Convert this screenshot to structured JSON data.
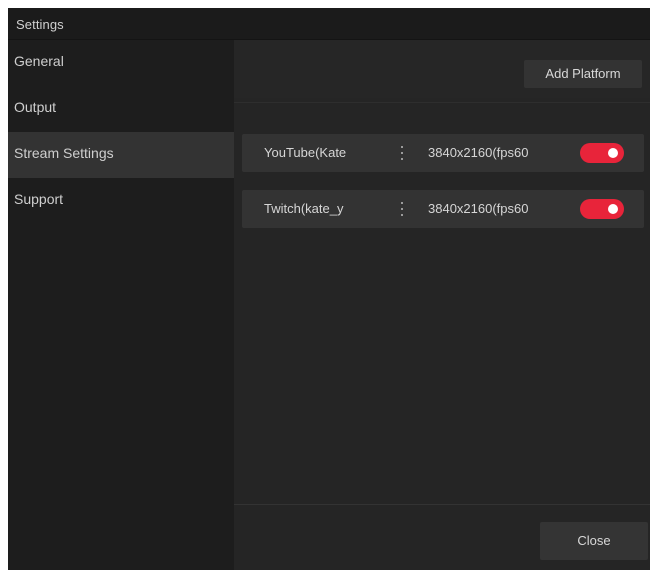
{
  "window": {
    "title": "Settings"
  },
  "sidebar": {
    "items": [
      {
        "label": "General",
        "active": false
      },
      {
        "label": "Output",
        "active": false
      },
      {
        "label": "Stream Settings",
        "active": true
      },
      {
        "label": "Support",
        "active": false
      }
    ]
  },
  "toolbar": {
    "add_platform_label": "Add Platform"
  },
  "platforms": [
    {
      "name": "YouTube(Kate",
      "resolution": "3840x2160(fps60",
      "enabled": true
    },
    {
      "name": "Twitch(kate_y",
      "resolution": "3840x2160(fps60",
      "enabled": true
    }
  ],
  "footer": {
    "close_label": "Close"
  },
  "colors": {
    "toggle_on": "#e8243a",
    "active_nav": "#333333",
    "background": "#1e1e1e"
  }
}
